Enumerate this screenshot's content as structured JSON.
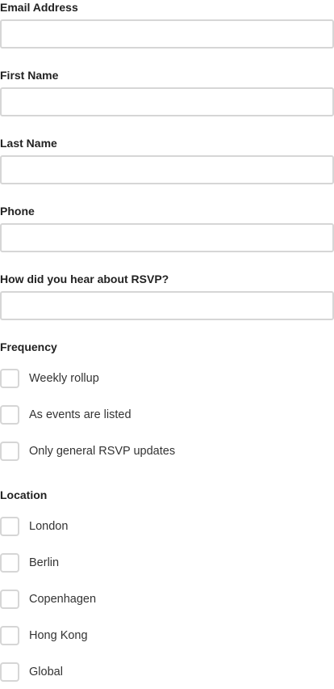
{
  "form": {
    "fields": [
      {
        "label": "Email Address",
        "value": "",
        "placeholder": ""
      },
      {
        "label": "First Name",
        "value": "",
        "placeholder": ""
      },
      {
        "label": "Last Name",
        "value": "",
        "placeholder": ""
      },
      {
        "label": "Phone",
        "value": "",
        "placeholder": ""
      },
      {
        "label": "How did you hear about RSVP?",
        "value": "",
        "placeholder": ""
      }
    ],
    "frequency": {
      "label": "Frequency",
      "options": [
        {
          "label": "Weekly rollup",
          "checked": false
        },
        {
          "label": "As events are listed",
          "checked": false
        },
        {
          "label": "Only general RSVP updates",
          "checked": false
        }
      ]
    },
    "location": {
      "label": "Location",
      "options": [
        {
          "label": "London",
          "checked": false
        },
        {
          "label": "Berlin",
          "checked": false
        },
        {
          "label": "Copenhagen",
          "checked": false
        },
        {
          "label": "Hong Kong",
          "checked": false
        },
        {
          "label": "Global",
          "checked": false
        }
      ]
    }
  },
  "colors": {
    "label_text": "#222222",
    "option_text": "#333333",
    "border": "#d6d6d6",
    "background": "#ffffff"
  }
}
